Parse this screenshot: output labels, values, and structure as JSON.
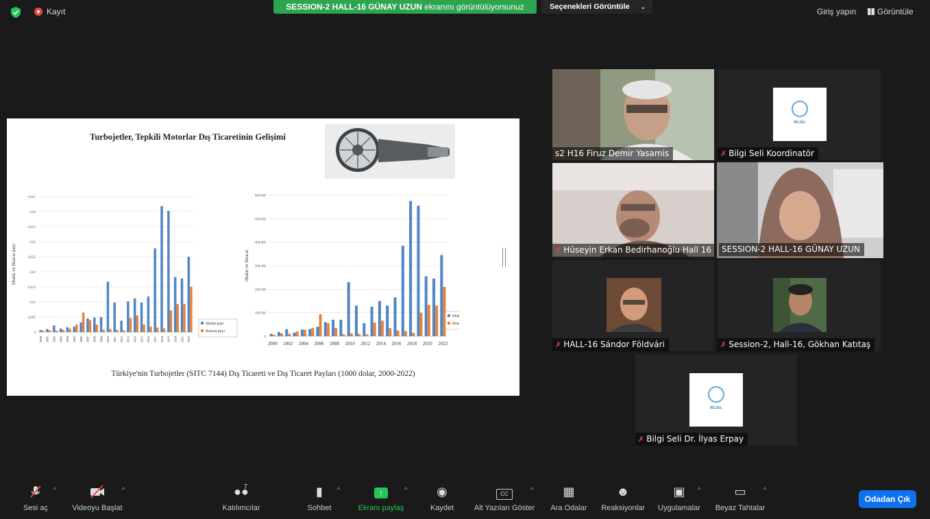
{
  "topbar": {
    "recording_label": "Kayıt",
    "share_banner_bold": "SESSION-2 HALL-16 GÜNAY UZUN",
    "share_banner_rest": "ekranını görüntülüyorsunuz",
    "view_options": "Seçenekleri Görüntüle",
    "signin": "Giriş yapın",
    "view": "Görüntüle",
    "colors": {
      "banner": "#2da44e",
      "record": "#e0494a"
    }
  },
  "slide": {
    "title": "Turbojetler, Tepkili Motorlar Dış Ticaretinin Gelişimi",
    "caption": "Türkiye'nin Turbojetler (SITC 7144) Dış Ticareti  ve Dış Ticaret Payları (1000 dolar, 2000-2022)"
  },
  "chart_data": [
    {
      "type": "bar",
      "ylabel": "ithalat ve ihracat payı",
      "ylim": [
        0,
        0.045
      ],
      "yticks": [
        "0",
        "0,005",
        "0,01",
        "0,015",
        "0,02",
        "0,025",
        "0,03",
        "0,035",
        "0,04",
        "0,045"
      ],
      "categories": [
        "2000",
        "2001",
        "2002",
        "2003",
        "2004",
        "2005",
        "2006",
        "2007",
        "2008",
        "2009",
        "2010",
        "2011",
        "2012",
        "2013",
        "2014",
        "2015",
        "2016",
        "2017",
        "2018",
        "2019",
        "2020",
        "2021",
        "2022"
      ],
      "series": [
        {
          "name": "ithalat payı",
          "color": "#4f86c6",
          "values": [
            0.0007,
            0.001,
            0.0022,
            0.0012,
            0.0016,
            0.0018,
            0.0032,
            0.0045,
            0.0048,
            0.005,
            0.0167,
            0.0098,
            0.0038,
            0.0102,
            0.0112,
            0.0098,
            0.0118,
            0.0278,
            0.0418,
            0.0402,
            0.0183,
            0.0178,
            0.025
          ]
        },
        {
          "name": "ihracat payı",
          "color": "#e8833a",
          "values": [
            0.0005,
            0.0006,
            0.0005,
            0.0008,
            0.0011,
            0.0025,
            0.0065,
            0.004,
            0.0025,
            0.0008,
            0.001,
            0.0008,
            0.0006,
            0.0047,
            0.0055,
            0.0025,
            0.0018,
            0.0015,
            0.0012,
            0.0072,
            0.0093,
            0.0093,
            0.015
          ]
        }
      ],
      "legend": "bottom-right",
      "grid": true
    },
    {
      "type": "bar",
      "ylabel": "ithalat ve ihracat",
      "ylim": [
        0,
        600000
      ],
      "yticks": [
        "0",
        "100.000",
        "200.000",
        "300.000",
        "400.000",
        "500.000",
        "600.000"
      ],
      "categories": [
        "2000",
        "2001",
        "2002",
        "2003",
        "2004",
        "2005",
        "2006",
        "2007",
        "2008",
        "2009",
        "2010",
        "2011",
        "2012",
        "2013",
        "2014",
        "2015",
        "2016",
        "2017",
        "2018",
        "2019",
        "2020",
        "2021",
        "2022"
      ],
      "xticks": [
        "2000",
        "2002",
        "2004",
        "2006",
        "2008",
        "2010",
        "2012",
        "2014",
        "2016",
        "2018",
        "2020",
        "2022"
      ],
      "series": [
        {
          "name": "ithalat",
          "color": "#4f86c6",
          "values": [
            10000,
            18000,
            30000,
            15000,
            28000,
            30000,
            40000,
            60000,
            70000,
            70000,
            230000,
            130000,
            55000,
            125000,
            150000,
            130000,
            165000,
            385000,
            575000,
            555000,
            255000,
            245000,
            345000
          ]
        },
        {
          "name": "ihracat",
          "color": "#e8833a",
          "values": [
            6000,
            12000,
            10000,
            20000,
            27000,
            35000,
            93000,
            55000,
            35000,
            8000,
            12000,
            10000,
            8000,
            58000,
            66000,
            34000,
            24000,
            22000,
            14000,
            100000,
            133000,
            130000,
            210000
          ]
        }
      ],
      "legend": "right",
      "grid": true
    }
  ],
  "participants": [
    {
      "name": "s2 H16 Firuz Demir Yasamis",
      "muted": false
    },
    {
      "name": "Bilgi Seli Koordinatör",
      "muted": true
    },
    {
      "name": "Hüseyin Erkan Bedirhanoğlu Hall 16",
      "muted": true
    },
    {
      "name": "SESSION-2 HALL-16 GÜNAY UZUN",
      "muted": false
    },
    {
      "name": "HALL-16 Sándor Földvári",
      "muted": true
    },
    {
      "name": "Session-2, Hall-16, Gökhan Katıtaş",
      "muted": true
    },
    {
      "name": "Bilgi Seli Dr. İlyas Erpay",
      "muted": true
    }
  ],
  "logo_text": "BİLSEL",
  "toolbar": {
    "unmute": "Sesi aç",
    "start_video": "Videoyu Başlat",
    "participants": "Katılımcılar",
    "participant_count": "7",
    "chat": "Sohbet",
    "share": "Ekranı paylaş",
    "record": "Kaydet",
    "captions": "Alt Yazıları Göster",
    "breakout": "Ara Odalar",
    "reactions": "Reaksiyonlar",
    "apps": "Uygulamalar",
    "whiteboard": "Beyaz Tahtalar",
    "leave": "Odadan Çık",
    "cc_icon_text": "CC"
  }
}
